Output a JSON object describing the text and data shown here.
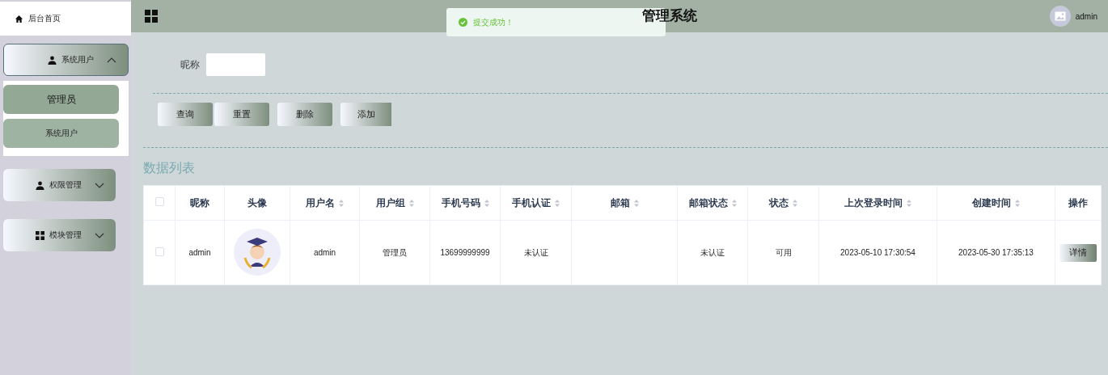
{
  "sidebar": {
    "items": [
      {
        "kind": "home",
        "label": "后台首页",
        "selected": false
      },
      {
        "kind": "user_group",
        "label": "系统用户",
        "expanded": true,
        "children": [
          {
            "label": "管理员",
            "selected": true
          },
          {
            "label": "系统用户",
            "selected": false
          }
        ]
      },
      {
        "kind": "user_group",
        "label": "权限管理",
        "expanded": false
      },
      {
        "kind": "grid_group",
        "label": "模块管理",
        "expanded": false
      }
    ]
  },
  "header": {
    "title": "管理系统",
    "user": "admin"
  },
  "toast": {
    "kind": "success",
    "message": "提交成功！"
  },
  "search": {
    "label": "昵称"
  },
  "actions": [
    "查询",
    "重置",
    "删除",
    "添加"
  ],
  "list_title": "数据列表",
  "table": {
    "columns": [
      {
        "kind": "checkbox"
      },
      {
        "label": "昵称",
        "sortable": false
      },
      {
        "label": "头像",
        "sortable": false
      },
      {
        "label": "用户名",
        "sortable": true
      },
      {
        "label": "用户组",
        "sortable": true
      },
      {
        "label": "手机号码",
        "sortable": true
      },
      {
        "label": "手机认证",
        "sortable": true
      },
      {
        "label": "邮箱",
        "sortable": true
      },
      {
        "label": "邮箱状态",
        "sortable": true
      },
      {
        "label": "状态",
        "sortable": true
      },
      {
        "label": "上次登录时间",
        "sortable": true
      },
      {
        "label": "创建时间",
        "sortable": true
      },
      {
        "label": "操作",
        "kind": "action",
        "sortable": false
      }
    ],
    "header_checked": false,
    "rows": [
      {
        "checked": false,
        "cells": [
          "",
          "admin",
          "",
          "admin",
          "管理员",
          "13699999999",
          "未认证",
          "",
          "未认证",
          "可用",
          "2023-05-10 17:30:54",
          "2023-05-30 17:35:13",
          "详情"
        ]
      }
    ]
  }
}
